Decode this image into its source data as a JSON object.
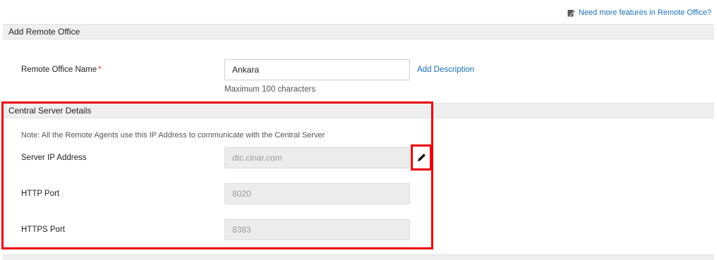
{
  "top_link": {
    "label": "Need more features in Remote Office?"
  },
  "add_remote_office": {
    "header": "Add Remote Office",
    "name_label": "Remote Office Name",
    "required_mark": "*",
    "name_value": "Ankara",
    "name_hint": "Maximum 100 characters",
    "add_description_link": "Add Description"
  },
  "central_server": {
    "header": "Central Server Details",
    "note": "Note: All the Remote Agents use this IP Address to communicate with the Central Server",
    "server_ip_label": "Server IP Address",
    "server_ip_value": "dtc.cinar.com",
    "http_port_label": "HTTP Port",
    "http_port_value": "8020",
    "https_port_label": "HTTPS Port",
    "https_port_value": "8383"
  },
  "colors": {
    "link": "#1a6fb5",
    "highlight": "#e8000b",
    "header_bg": "#efefef"
  },
  "icons": {
    "top_link_icon": "edit-note-icon",
    "edit_icon": "pencil-icon"
  }
}
